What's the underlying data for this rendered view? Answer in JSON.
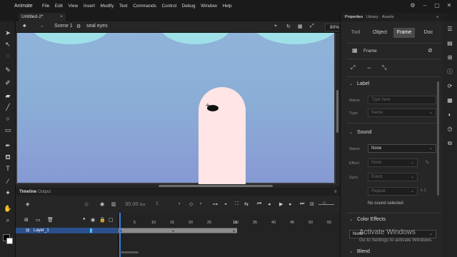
{
  "app": {
    "name": "Animate"
  },
  "menu": [
    "File",
    "Edit",
    "View",
    "Insert",
    "Modify",
    "Text",
    "Commands",
    "Control",
    "Debug",
    "Window",
    "Help"
  ],
  "document": {
    "tab_label": "Untitled-2*",
    "close": "×"
  },
  "editbar": {
    "scene": "Scene 1",
    "symbol": "seal eyes",
    "zoom": "80%"
  },
  "timeline": {
    "tab_timeline": "Timeline",
    "tab_output": "Output",
    "fps": "30.00",
    "fps_unit": "fps",
    "frame_counter": "1",
    "layer_name": "Layer_1",
    "ruler": [
      "1s",
      "5",
      "10",
      "15",
      "20",
      "25",
      "30",
      "35",
      "40",
      "45",
      "50",
      "55"
    ],
    "highlight_marker": "1s"
  },
  "properties": {
    "tabs": [
      "Properties",
      "Library",
      "Assets"
    ],
    "subtabs": [
      "Tool",
      "Object",
      "Frame",
      "Doc"
    ],
    "selected_subtab": "Frame",
    "frame_label": "Frame",
    "label_section": {
      "title": "Label",
      "name_label": "Name",
      "name_placeholder": "Type here",
      "type_label": "Type",
      "type_value": "Name"
    },
    "sound_section": {
      "title": "Sound",
      "name_label": "Name",
      "name_value": "None",
      "effect_label": "Effect",
      "effect_value": "None",
      "sync_label": "Sync",
      "sync_value": "Event",
      "repeat_value": "Repeat",
      "repeat_count": "x 1",
      "no_sound": "No sound selected"
    },
    "color_effects": {
      "title": "Color Effects",
      "value": "None"
    },
    "blend": {
      "title": "Blend"
    }
  },
  "watermark": {
    "title": "Activate Windows",
    "subtitle": "Go to Settings to activate Windows."
  },
  "colors": {
    "stage_top": "#8fb3d9",
    "seal": "#ffe5e5",
    "cloud": "#9fe0e8",
    "layer_selected": "#2b4f8d",
    "accent": "#3b7bde"
  }
}
